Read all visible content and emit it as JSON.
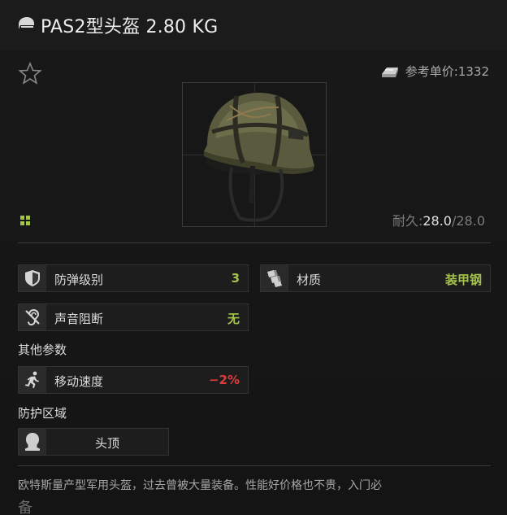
{
  "title": "PAS2型头盔 2.80 KG",
  "price": {
    "label": "参考单价:1332"
  },
  "durability": {
    "label": "耐久:",
    "current": "28.0",
    "max": "/28.0"
  },
  "stats": {
    "armor_class": {
      "label": "防弹级别",
      "value": "3"
    },
    "material": {
      "label": "材质",
      "value": "装甲钢"
    },
    "sound_block": {
      "label": "声音阻断",
      "value": "无"
    }
  },
  "other_params": {
    "heading": "其他参数",
    "move_speed": {
      "label": "移动速度",
      "value": "−2%"
    }
  },
  "protection": {
    "heading": "防护区域",
    "zone": "头顶"
  },
  "description": {
    "line1": "欧特斯量产型军用头盔，过去曾被大量装备。性能好价格也不贵，入门必",
    "line2": "备"
  },
  "colors": {
    "accent_green": "#a5c34a",
    "negative_red": "#e23a3a"
  },
  "icons": {
    "title": "helmet-chat-icon",
    "favorite": "star-outline-icon",
    "price": "bullion-icon",
    "grid": "grid-icon",
    "armor": "shield-icon",
    "material": "armor-plates-icon",
    "sound": "ear-mute-icon",
    "speed": "running-man-icon",
    "zone": "head-silhouette-icon"
  }
}
